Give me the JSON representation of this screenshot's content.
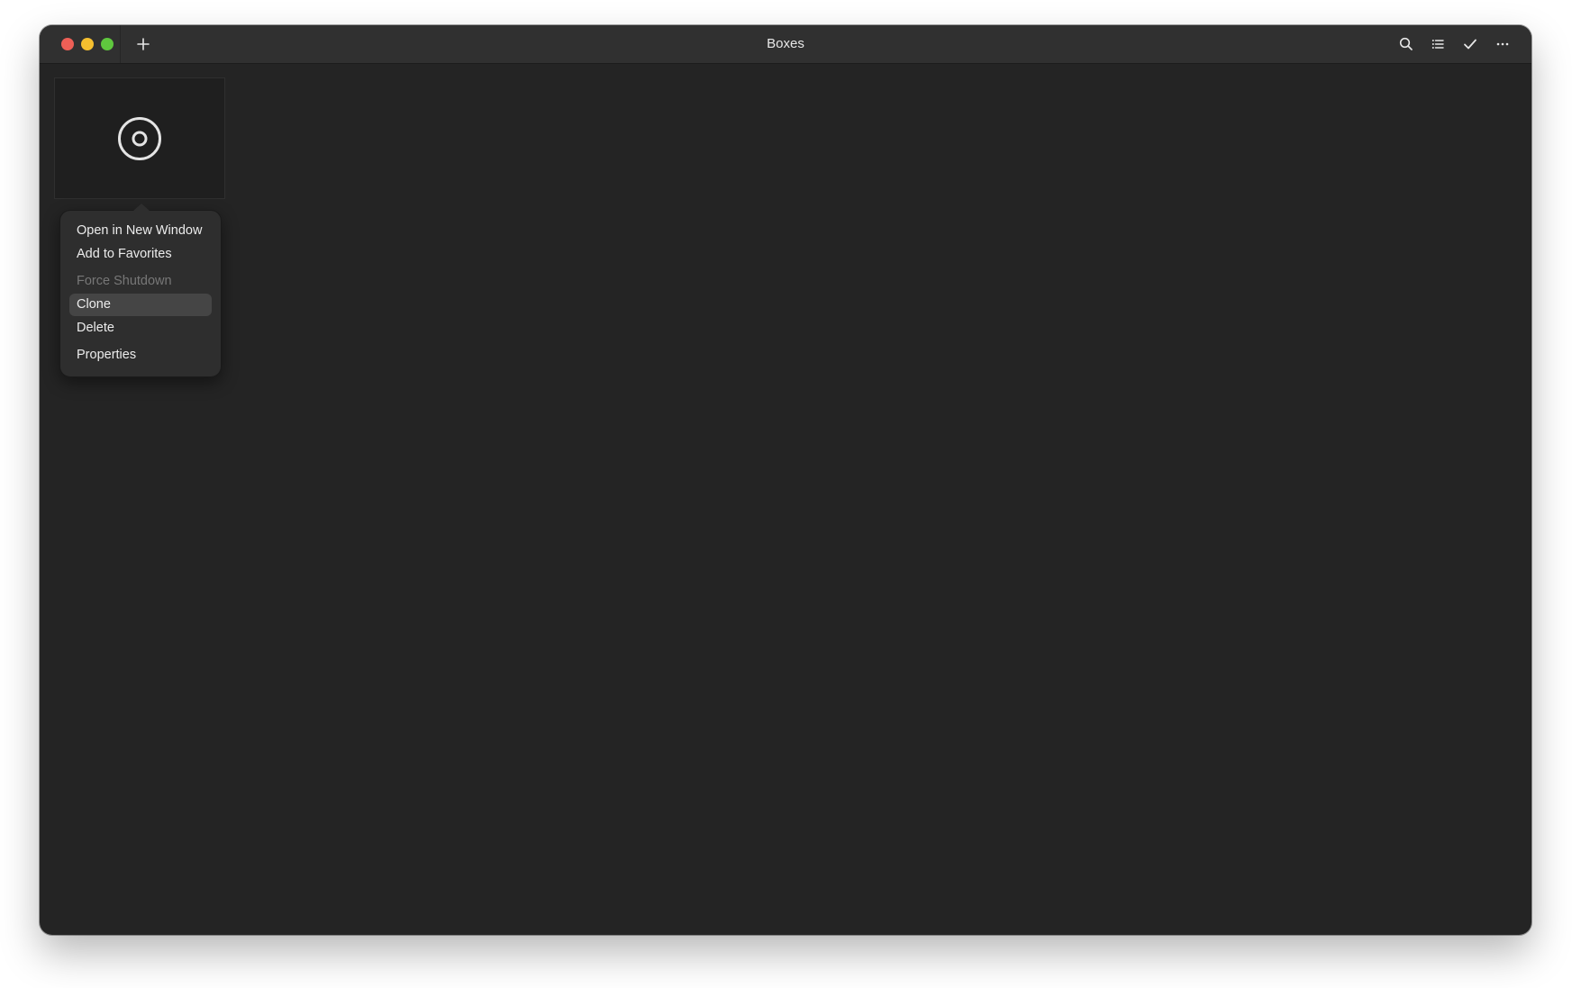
{
  "window": {
    "title": "Boxes",
    "traffic_colors": {
      "close": "#ed5f56",
      "minimize": "#f5bf2f",
      "maximize": "#5fc73e"
    }
  },
  "toolbar": {
    "new_icon": "plus-icon",
    "search_icon": "search-icon",
    "list_icon": "list-view-icon",
    "select_icon": "checkmark-icon",
    "more_icon": "more-icon"
  },
  "boxes": [
    {
      "icon": "disc-icon"
    }
  ],
  "context_menu": {
    "items": [
      {
        "label": "Open in New Window",
        "disabled": false,
        "highlighted": false
      },
      {
        "label": "Add to Favorites",
        "disabled": false,
        "highlighted": false
      },
      {
        "label": "Force Shutdown",
        "disabled": true,
        "highlighted": false
      },
      {
        "label": "Clone",
        "disabled": false,
        "highlighted": true
      },
      {
        "label": "Delete",
        "disabled": false,
        "highlighted": false
      },
      {
        "label": "Properties",
        "disabled": false,
        "highlighted": false
      }
    ]
  }
}
